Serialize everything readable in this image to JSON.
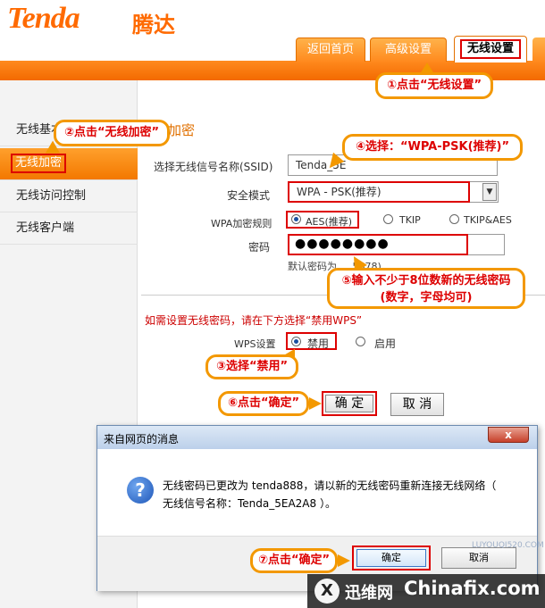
{
  "header": {
    "logo_text": "Tenda",
    "logo_cn": "腾达",
    "tabs": [
      {
        "label": "返回首页"
      },
      {
        "label": "高级设置"
      },
      {
        "label": "无线设置",
        "active": true
      }
    ]
  },
  "sidebar": {
    "items": [
      {
        "label": "无线基本"
      },
      {
        "label": "无线加密",
        "active": true
      },
      {
        "label": "无线访问控制"
      },
      {
        "label": "无线客户端"
      }
    ]
  },
  "main": {
    "section_title": "加密",
    "ssid": {
      "label": "选择无线信号名称(SSID)",
      "value": "Tenda_5E"
    },
    "security_mode": {
      "label": "安全模式",
      "value": "WPA - PSK(推荐)"
    },
    "wpa_rule": {
      "label": "WPA加密规则",
      "options": [
        {
          "label": "AES(推荐)",
          "selected": true
        },
        {
          "label": "TKIP",
          "selected": false
        },
        {
          "label": "TKIP&AES",
          "selected": false
        }
      ]
    },
    "password": {
      "label": "密码",
      "value": "●●●●●●●●",
      "default_hint": "默认密码为 ... 5678)"
    },
    "wps_note": "如需设置无线密码，请在下方选择“禁用WPS”",
    "wps": {
      "label": "WPS设置",
      "options": [
        {
          "label": "禁用",
          "selected": true
        },
        {
          "label": "启用",
          "selected": false
        }
      ]
    },
    "ok_label": "确 定",
    "cancel_label": "取 消"
  },
  "callouts": {
    "c1": "①点击“无线设置”",
    "c2": "②点击“无线加密”",
    "c3": "③选择“禁用”",
    "c4": "④选择：“WPA-PSK(推荐)”",
    "c5_line1": "⑤输入不少于8位数新的无线密码",
    "c5_line2": "(数字，字母均可)",
    "c6": "⑥点击“确定”",
    "c7": "⑦点击“确定”"
  },
  "dialog": {
    "title": "来自网页的消息",
    "close": "x",
    "icon": "?",
    "message_line1": "无线密码已更改为 tenda888，请以新的无线密码重新连接无线网络（",
    "message_line2": "无线信号名称：Tenda_5EA2A8 ）。",
    "ok_label": "确定",
    "cancel_label": "取消"
  },
  "watermark": {
    "logo": "X",
    "cn": "迅维网",
    "en": "Chinafix.com",
    "faint": "LUYOUQI520.COM"
  },
  "colors": {
    "brand_orange": "#ff6a00",
    "highlight_red": "#dd0000",
    "callout_border": "#f39800"
  }
}
